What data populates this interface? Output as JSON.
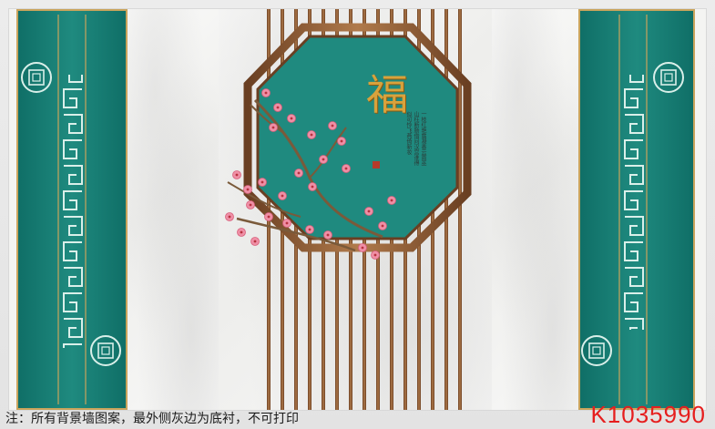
{
  "note": "注：所有背景墙图案，最外侧灰边为底衬，不可打印",
  "code": "K1035990",
  "character": "福",
  "poem": "一枝红艳露凝香云雨巫山枉断肠借问汉宫谁得似可怜飞燕倚新妆",
  "colors": {
    "teal": "#1f8a7f",
    "gold": "#c9a45c",
    "wood": "#8a5a35",
    "blossom": "#ef8fa6"
  }
}
